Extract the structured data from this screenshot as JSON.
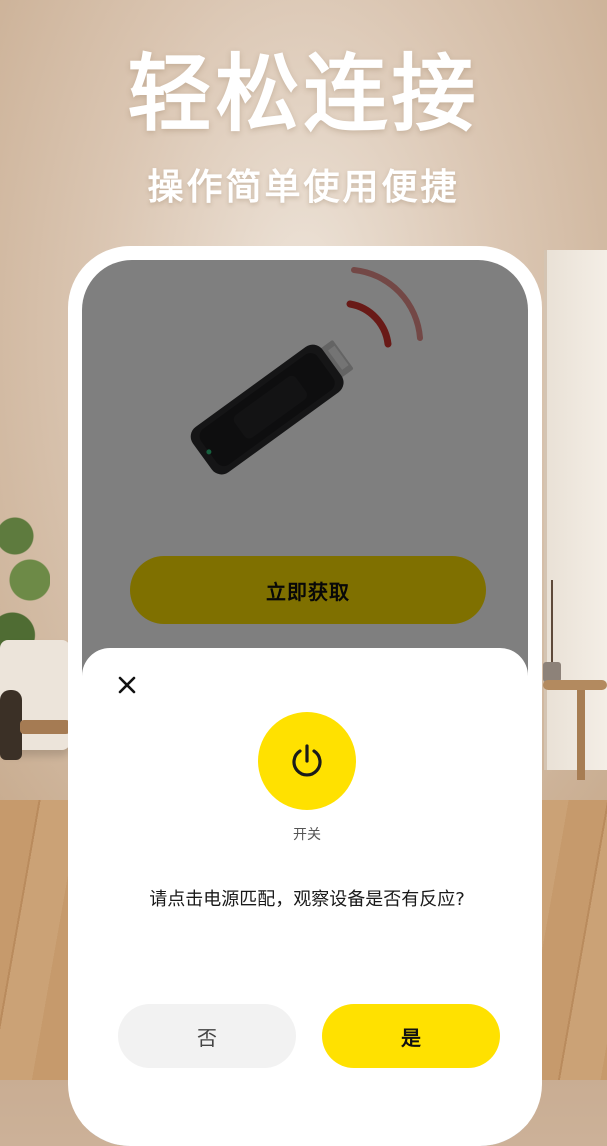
{
  "promo": {
    "title": "轻松连接",
    "subtitle": "操作简单使用便捷"
  },
  "device": {
    "image": "usb-ir-dongle",
    "cta_label": "立即获取"
  },
  "dialog": {
    "power_label": "开关",
    "question": "请点击电源匹配，观察设备是否有反应?",
    "no_label": "否",
    "yes_label": "是"
  },
  "colors": {
    "accent": "#FFE100",
    "signal": "#D3352E",
    "overlay": "rgba(0,0,0,0.5)"
  }
}
